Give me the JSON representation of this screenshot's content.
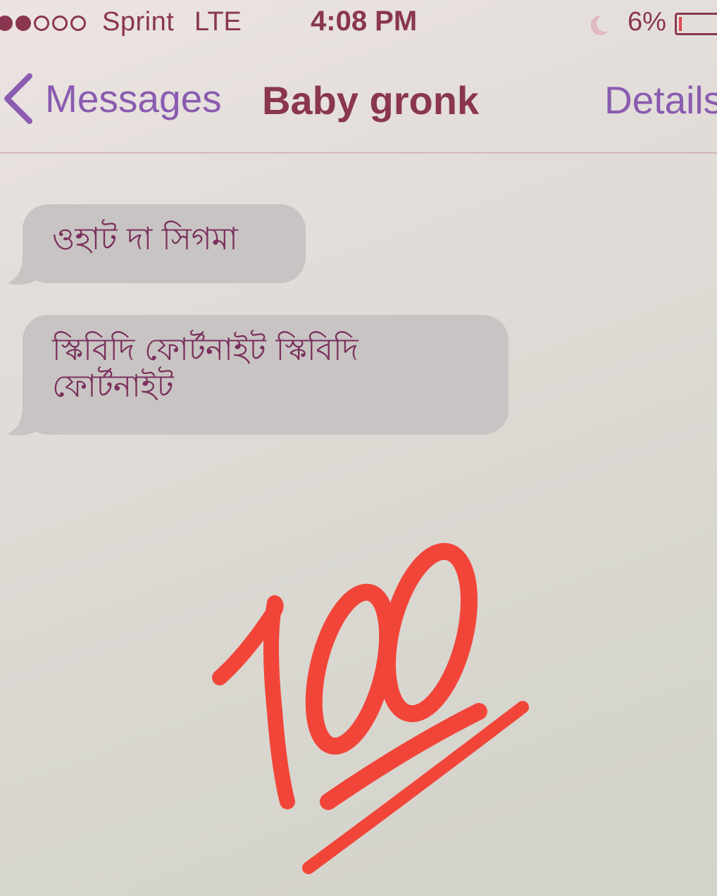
{
  "status_bar": {
    "signal_bars_filled": 2,
    "signal_bars_total": 5,
    "carrier": "Sprint",
    "network": "LTE",
    "time": "4:08 PM",
    "do_not_disturb_icon": "moon-icon",
    "battery_percent": "6%",
    "battery_level": 0.06,
    "battery_icon": "battery-icon"
  },
  "nav": {
    "back_label": "Messages",
    "back_icon": "chevron-left-icon",
    "title": "Baby gronk",
    "details_label": "Details"
  },
  "messages": [
    {
      "direction": "incoming",
      "text": "ওহাট দা সিগমা"
    },
    {
      "direction": "incoming",
      "text": "স্কিবিদি ফোর্টনাইট স্কিবিদি ফোর্টনাইট"
    }
  ],
  "emoji": {
    "name": "hundred-points-icon",
    "color": "#f2453a"
  },
  "colors": {
    "status_text": "#8a3650",
    "accent": "#8a5bb0",
    "bubble_bg": "#c8c4c3",
    "bubble_text": "#7a2f5c",
    "battery_low": "#e24a4a"
  }
}
